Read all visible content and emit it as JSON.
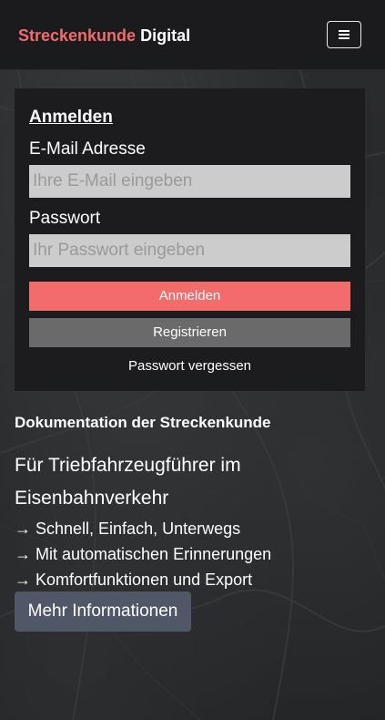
{
  "navbar": {
    "brand_primary": "Streckenkunde",
    "brand_secondary": "Digital",
    "menu_icon": "hamburger-menu-icon"
  },
  "login": {
    "title": "Anmelden",
    "email_label": "E-Mail Adresse",
    "email_placeholder": "Ihre E-Mail eingeben",
    "email_value": "",
    "password_label": "Passwort",
    "password_placeholder": "Ihr Passwort eingeben",
    "password_value": "",
    "login_button": "Anmelden",
    "register_button": "Registrieren",
    "forgot_link": "Passwort vergessen"
  },
  "info": {
    "title": "Dokumentation der Streckenkunde",
    "subtitle": "Für Triebfahrzeugführer im Eisenbahnverkehr",
    "features": [
      "→ Schnell, Einfach, Unterwegs",
      "→ Mit automatischen Erinnerungen",
      "→ Komfortfunktionen und Export"
    ],
    "more_button": "Mehr Informationen"
  },
  "colors": {
    "accent": "#f46b6b",
    "navbar_bg": "#1b1b1d",
    "card_bg": "#1c1c1e",
    "input_bg": "#cccccc",
    "register_bg": "#6a6a6a",
    "more_button_bg": "#505868"
  }
}
